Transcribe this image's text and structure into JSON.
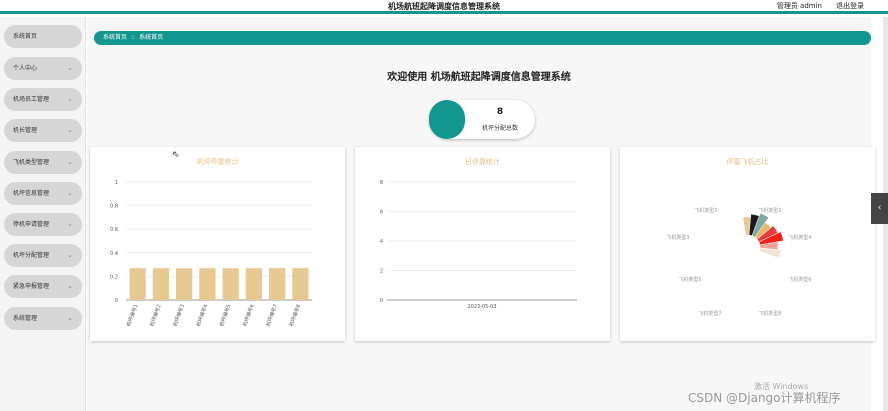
{
  "header": {
    "title": "机场航班起降调度信息管理系统",
    "user_label": "管理员 admin",
    "logout_label": "退出登录"
  },
  "sidebar": {
    "items": [
      {
        "label": "系统首页",
        "has_chevron": false
      },
      {
        "label": "个人中心",
        "has_chevron": true
      },
      {
        "label": "机场员工管理",
        "has_chevron": true
      },
      {
        "label": "机长管理",
        "has_chevron": true
      },
      {
        "label": "飞机类型管理",
        "has_chevron": true
      },
      {
        "label": "机坪信息管理",
        "has_chevron": true
      },
      {
        "label": "停机申请管理",
        "has_chevron": true
      },
      {
        "label": "机坪分配管理",
        "has_chevron": true
      },
      {
        "label": "紧急申报管理",
        "has_chevron": true
      },
      {
        "label": "系统管理",
        "has_chevron": true
      }
    ]
  },
  "breadcrumb": {
    "home": "系统首页",
    "separator": "::",
    "current": "系统首页"
  },
  "welcome": "欢迎使用 机场航班起降调度信息管理系统",
  "stat": {
    "value": "8",
    "label": "机坪分配总数"
  },
  "colors": {
    "accent": "#139590",
    "bar": "#e6c993",
    "chart_title": "#e3c189"
  },
  "chart_data": [
    {
      "type": "bar",
      "title": "机坪停靠统计",
      "categories": [
        "机坪编号1",
        "机坪编号2",
        "机坪编号3",
        "机坪编号4",
        "机坪编号5",
        "机坪编号6",
        "机坪编号7",
        "机坪编号8"
      ],
      "values": [
        0.27,
        0.27,
        0.27,
        0.27,
        0.27,
        0.27,
        0.27,
        0.27
      ],
      "yticks": [
        "0",
        "0.2",
        "0.4",
        "0.6",
        "0.8",
        "1"
      ],
      "ylim": [
        0,
        1
      ]
    },
    {
      "type": "line",
      "title": "日停靠统计",
      "categories": [
        "2023-05-03"
      ],
      "yticks": [
        "0",
        "2",
        "4",
        "6",
        "8"
      ],
      "ylim": [
        0,
        8
      ]
    },
    {
      "type": "pie",
      "title": "停靠飞机占比",
      "labels": [
        "飞机类型1",
        "飞机类型2",
        "飞机类型3",
        "飞机类型4",
        "飞机类型5",
        "飞机类型6",
        "飞机类型7",
        "飞机类型8"
      ],
      "slice_colors": [
        "#e6c993",
        "#1a1a1a",
        "#7fa9a3",
        "#e8b96a",
        "#e23c3c",
        "#f0201a",
        "#f5a39a",
        "#f2e6d2"
      ]
    }
  ],
  "watermark": {
    "line1": "激活 Windows",
    "line2": "CSDN @Django计算机程序"
  }
}
